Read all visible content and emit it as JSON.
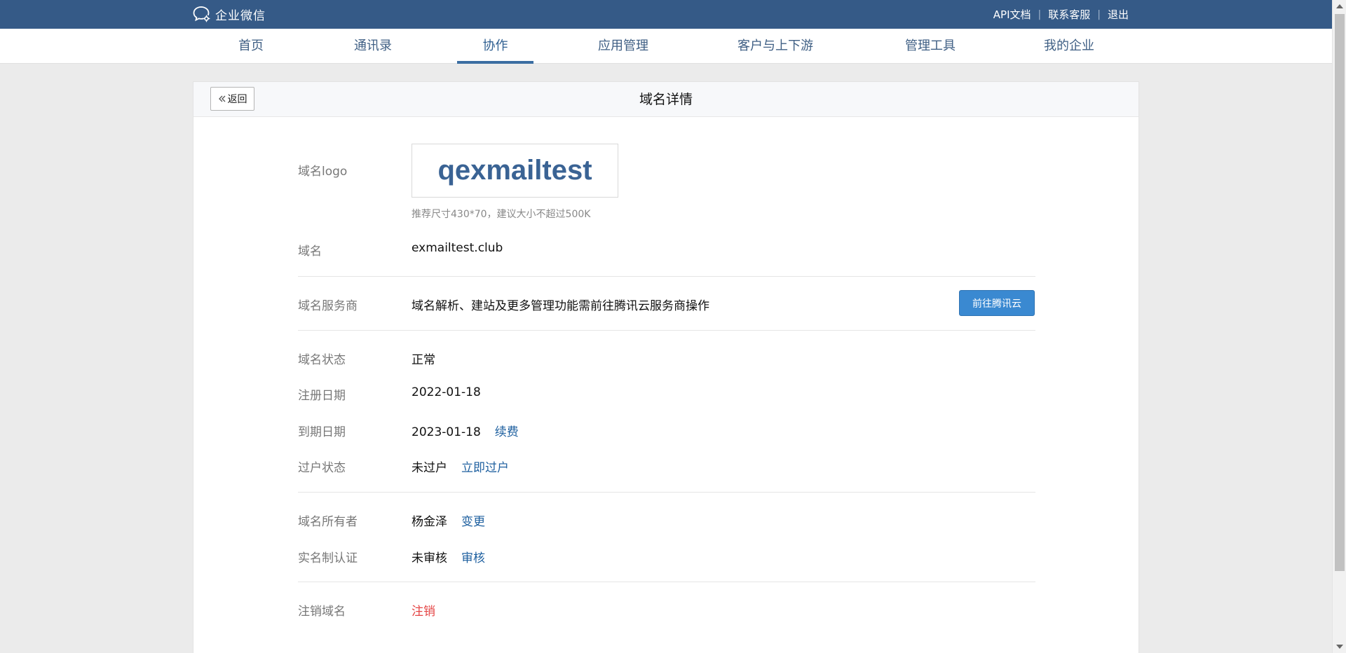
{
  "brand": {
    "name": "企业微信"
  },
  "top_links": {
    "api_docs": "API文档",
    "support": "联系客服",
    "logout": "退出",
    "separator": "|"
  },
  "nav": {
    "items": [
      {
        "label": "首页"
      },
      {
        "label": "通讯录"
      },
      {
        "label": "协作",
        "active": true
      },
      {
        "label": "应用管理"
      },
      {
        "label": "客户与上下游"
      },
      {
        "label": "管理工具"
      },
      {
        "label": "我的企业"
      }
    ]
  },
  "page": {
    "back_label": "返回",
    "title": "域名详情"
  },
  "domain": {
    "logo_label": "域名logo",
    "logo_text": "qexmailtest",
    "logo_hint": "推荐尺寸430*70，建议大小不超过500K",
    "name_label": "域名",
    "name_value": "exmailtest.club",
    "provider_label": "域名服务商",
    "provider_value": "域名解析、建站及更多管理功能需前往腾讯云服务商操作",
    "provider_button": "前往腾讯云",
    "status_label": "域名状态",
    "status_value": "正常",
    "register_label": "注册日期",
    "register_value": "2022-01-18",
    "expire_label": "到期日期",
    "expire_value": "2023-01-18",
    "renew_link": "续费",
    "transfer_label": "过户状态",
    "transfer_value": "未过户",
    "transfer_link": "立即过户",
    "owner_label": "域名所有者",
    "owner_value": "杨金泽",
    "owner_link": "变更",
    "realname_label": "实名制认证",
    "realname_value": "未审核",
    "realname_link": "审核",
    "cancel_label": "注销域名",
    "cancel_link": "注销"
  },
  "colors": {
    "topbar": "#355a87",
    "accent": "#3a89d1",
    "link": "#1d5f9f",
    "danger": "#e54545"
  }
}
